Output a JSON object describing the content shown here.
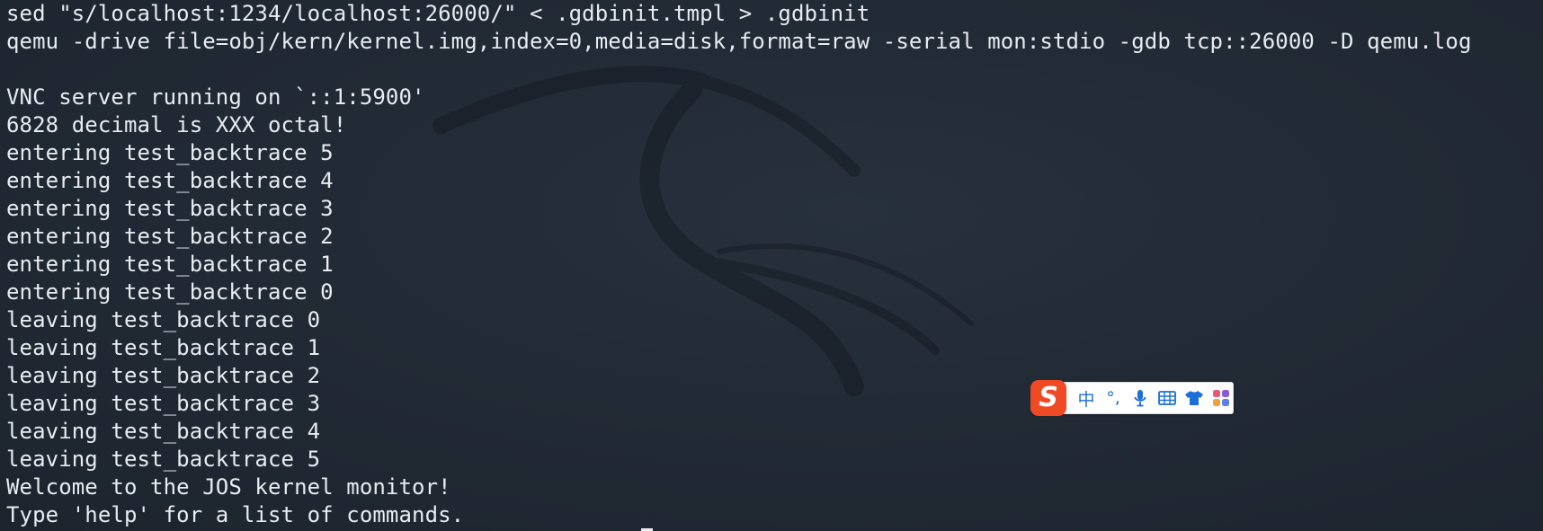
{
  "terminal": {
    "lines": [
      "sed \"s/localhost:1234/localhost:26000/\" < .gdbinit.tmpl > .gdbinit",
      "qemu -drive file=obj/kern/kernel.img,index=0,media=disk,format=raw -serial mon:stdio -gdb tcp::26000 -D qemu.log",
      "",
      "VNC server running on `::1:5900'",
      "6828 decimal is XXX octal!",
      "entering test_backtrace 5",
      "entering test_backtrace 4",
      "entering test_backtrace 3",
      "entering test_backtrace 2",
      "entering test_backtrace 1",
      "entering test_backtrace 0",
      "leaving test_backtrace 0",
      "leaving test_backtrace 1",
      "leaving test_backtrace 2",
      "leaving test_backtrace 3",
      "leaving test_backtrace 4",
      "leaving test_backtrace 5",
      "Welcome to the JOS kernel monitor!",
      "Type 'help' for a list of commands."
    ]
  },
  "ime_toolbar": {
    "logo": "S",
    "mode_label": "中",
    "punctuation_label": "°,",
    "icons": [
      "sogou-logo-icon",
      "microphone-icon",
      "keyboard-icon",
      "skin-shirt-icon",
      "toolbox-icon"
    ]
  },
  "colors": {
    "background": "#1f2631",
    "text": "#e8ecf1",
    "ime_accent": "#1a6fd8",
    "ime_logo": "#ef4a24"
  }
}
